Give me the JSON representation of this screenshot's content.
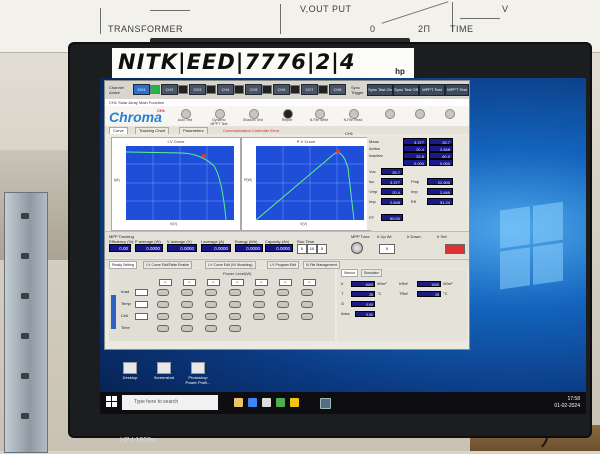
{
  "poster": {
    "transformer": "TRANSFORMER",
    "vout": "V,OUT PUT",
    "two_pi": "2Π",
    "time": "TIME",
    "zero": "0",
    "v_label": "V"
  },
  "sticker": {
    "text": "NITK|EED|7776|2|4",
    "brand": "hp"
  },
  "monitor": {
    "model": "HP L1908w"
  },
  "app": {
    "channel_label": "Channel Active",
    "channels": [
      "CH1",
      "CH2",
      "CH3",
      "CH4",
      "CH5",
      "CH6",
      "CH7",
      "CH8"
    ],
    "sync_label": "Sync Trigger",
    "sync_buttons": [
      "Sync Test On",
      "Sync Test Off",
      "MPPT Test On",
      "MPPT Test Off"
    ],
    "window_title": "CH1 Solar Array Main Function",
    "brand": "Chroma",
    "brand_sub": "CH1",
    "tools": [
      "Auto Test",
      "Dynamic MPPT Test",
      "Shadow Test",
      "Report",
      "N-File Write",
      "N-File Read",
      "",
      "",
      ""
    ],
    "tabs": [
      "Curve",
      "Tracking Chart",
      "Parameters"
    ],
    "tab_note": "Communication Controller Error",
    "iv_title": "I-V Curve",
    "pv_title": "P-V Curve",
    "axis_v": "V(V)",
    "axis_i": "I(A)",
    "axis_p": "P(W)",
    "chart_menu": "CH1",
    "right_labels": [
      "Meas",
      "Active",
      "Inactive",
      "Voc",
      "Isc",
      "Vmp",
      "Imp",
      "FF",
      "Pmp",
      "Eff"
    ],
    "right_values": {
      "voc": "25.7",
      "isc": "3.377",
      "vmp": "20.4",
      "imp": "2.848",
      "pmp": "22.600",
      "imp2": "2.649",
      "eff": "51.24",
      "ff": "60.00"
    },
    "right_table": [
      "3.377",
      "25.7",
      "20.4",
      "2.848",
      "22.6",
      "60.0",
      "0.000",
      "0.000"
    ],
    "mppt": {
      "label": "MPP Tracking",
      "fields": [
        "Efficiency (%)",
        "P average (W)",
        "V average (V)",
        "I average (A)",
        "Energy (Wh)",
        "Capacity (Ah)",
        "Run Time",
        "MPP Tune",
        "Ir Up Wr",
        "Ir Down",
        "Ir Set"
      ],
      "values": [
        "0.00",
        "0.0000",
        "0.0000",
        "0.0000",
        "0.0000",
        "0.0000",
        "0",
        "10",
        "0",
        "0"
      ]
    },
    "bottom_tabs": [
      "Ready Setting",
      "I-V Curve Edit/Table Enable",
      "I-V Curve Edit (I/V Modeling)",
      "I-V Program Edit",
      "N-File Management"
    ],
    "power_level": "Power Level(W)",
    "grid_rows": [
      "Irrad",
      "Temp",
      "Cell",
      "Time"
    ],
    "grid_cols": [
      "L",
      "L",
      "L",
      "L",
      "L",
      "L",
      "L",
      "L"
    ],
    "sensors_tab": [
      "Sensor",
      "Simulator"
    ],
    "sensors": [
      {
        "label": "Ir",
        "value": "1000",
        "unit": "W/m²"
      },
      {
        "label": "T",
        "value": "25",
        "unit": "°C"
      },
      {
        "label": "G",
        "value": "0.00",
        "unit": ""
      },
      {
        "label": "Area",
        "value": "0.00",
        "unit": ""
      },
      {
        "label": "IrRef",
        "value": "1000",
        "unit": "W/m²"
      },
      {
        "label": "TRef",
        "value": "25",
        "unit": "°C"
      }
    ]
  },
  "desktop": {
    "icons": [
      "Desktop",
      "Screenshot",
      "Photoshop"
    ],
    "icons_line2": [
      "",
      "",
      "Power Profil..."
    ],
    "search_placeholder": "Type here to search",
    "clock_time": "17:58",
    "clock_date": "01-02-2024"
  }
}
